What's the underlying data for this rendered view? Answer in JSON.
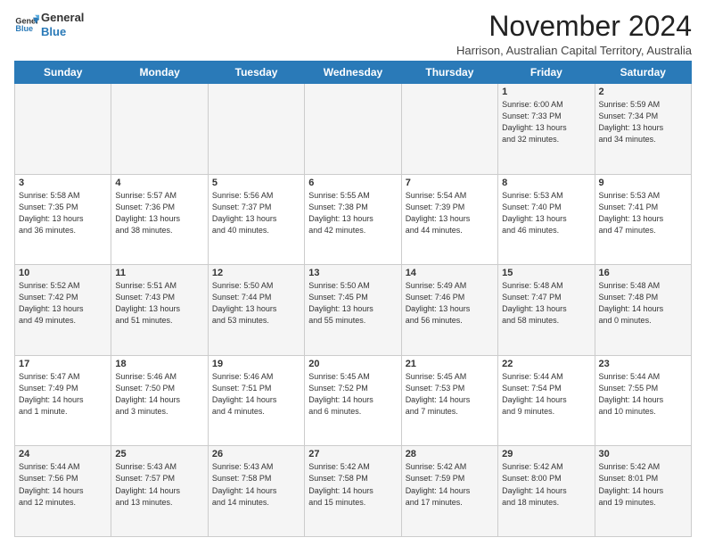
{
  "logo": {
    "line1": "General",
    "line2": "Blue"
  },
  "title": "November 2024",
  "location": "Harrison, Australian Capital Territory, Australia",
  "days_header": [
    "Sunday",
    "Monday",
    "Tuesday",
    "Wednesday",
    "Thursday",
    "Friday",
    "Saturday"
  ],
  "weeks": [
    [
      {
        "day": "",
        "info": ""
      },
      {
        "day": "",
        "info": ""
      },
      {
        "day": "",
        "info": ""
      },
      {
        "day": "",
        "info": ""
      },
      {
        "day": "",
        "info": ""
      },
      {
        "day": "1",
        "info": "Sunrise: 6:00 AM\nSunset: 7:33 PM\nDaylight: 13 hours\nand 32 minutes."
      },
      {
        "day": "2",
        "info": "Sunrise: 5:59 AM\nSunset: 7:34 PM\nDaylight: 13 hours\nand 34 minutes."
      }
    ],
    [
      {
        "day": "3",
        "info": "Sunrise: 5:58 AM\nSunset: 7:35 PM\nDaylight: 13 hours\nand 36 minutes."
      },
      {
        "day": "4",
        "info": "Sunrise: 5:57 AM\nSunset: 7:36 PM\nDaylight: 13 hours\nand 38 minutes."
      },
      {
        "day": "5",
        "info": "Sunrise: 5:56 AM\nSunset: 7:37 PM\nDaylight: 13 hours\nand 40 minutes."
      },
      {
        "day": "6",
        "info": "Sunrise: 5:55 AM\nSunset: 7:38 PM\nDaylight: 13 hours\nand 42 minutes."
      },
      {
        "day": "7",
        "info": "Sunrise: 5:54 AM\nSunset: 7:39 PM\nDaylight: 13 hours\nand 44 minutes."
      },
      {
        "day": "8",
        "info": "Sunrise: 5:53 AM\nSunset: 7:40 PM\nDaylight: 13 hours\nand 46 minutes."
      },
      {
        "day": "9",
        "info": "Sunrise: 5:53 AM\nSunset: 7:41 PM\nDaylight: 13 hours\nand 47 minutes."
      }
    ],
    [
      {
        "day": "10",
        "info": "Sunrise: 5:52 AM\nSunset: 7:42 PM\nDaylight: 13 hours\nand 49 minutes."
      },
      {
        "day": "11",
        "info": "Sunrise: 5:51 AM\nSunset: 7:43 PM\nDaylight: 13 hours\nand 51 minutes."
      },
      {
        "day": "12",
        "info": "Sunrise: 5:50 AM\nSunset: 7:44 PM\nDaylight: 13 hours\nand 53 minutes."
      },
      {
        "day": "13",
        "info": "Sunrise: 5:50 AM\nSunset: 7:45 PM\nDaylight: 13 hours\nand 55 minutes."
      },
      {
        "day": "14",
        "info": "Sunrise: 5:49 AM\nSunset: 7:46 PM\nDaylight: 13 hours\nand 56 minutes."
      },
      {
        "day": "15",
        "info": "Sunrise: 5:48 AM\nSunset: 7:47 PM\nDaylight: 13 hours\nand 58 minutes."
      },
      {
        "day": "16",
        "info": "Sunrise: 5:48 AM\nSunset: 7:48 PM\nDaylight: 14 hours\nand 0 minutes."
      }
    ],
    [
      {
        "day": "17",
        "info": "Sunrise: 5:47 AM\nSunset: 7:49 PM\nDaylight: 14 hours\nand 1 minute."
      },
      {
        "day": "18",
        "info": "Sunrise: 5:46 AM\nSunset: 7:50 PM\nDaylight: 14 hours\nand 3 minutes."
      },
      {
        "day": "19",
        "info": "Sunrise: 5:46 AM\nSunset: 7:51 PM\nDaylight: 14 hours\nand 4 minutes."
      },
      {
        "day": "20",
        "info": "Sunrise: 5:45 AM\nSunset: 7:52 PM\nDaylight: 14 hours\nand 6 minutes."
      },
      {
        "day": "21",
        "info": "Sunrise: 5:45 AM\nSunset: 7:53 PM\nDaylight: 14 hours\nand 7 minutes."
      },
      {
        "day": "22",
        "info": "Sunrise: 5:44 AM\nSunset: 7:54 PM\nDaylight: 14 hours\nand 9 minutes."
      },
      {
        "day": "23",
        "info": "Sunrise: 5:44 AM\nSunset: 7:55 PM\nDaylight: 14 hours\nand 10 minutes."
      }
    ],
    [
      {
        "day": "24",
        "info": "Sunrise: 5:44 AM\nSunset: 7:56 PM\nDaylight: 14 hours\nand 12 minutes."
      },
      {
        "day": "25",
        "info": "Sunrise: 5:43 AM\nSunset: 7:57 PM\nDaylight: 14 hours\nand 13 minutes."
      },
      {
        "day": "26",
        "info": "Sunrise: 5:43 AM\nSunset: 7:58 PM\nDaylight: 14 hours\nand 14 minutes."
      },
      {
        "day": "27",
        "info": "Sunrise: 5:42 AM\nSunset: 7:58 PM\nDaylight: 14 hours\nand 15 minutes."
      },
      {
        "day": "28",
        "info": "Sunrise: 5:42 AM\nSunset: 7:59 PM\nDaylight: 14 hours\nand 17 minutes."
      },
      {
        "day": "29",
        "info": "Sunrise: 5:42 AM\nSunset: 8:00 PM\nDaylight: 14 hours\nand 18 minutes."
      },
      {
        "day": "30",
        "info": "Sunrise: 5:42 AM\nSunset: 8:01 PM\nDaylight: 14 hours\nand 19 minutes."
      }
    ]
  ]
}
